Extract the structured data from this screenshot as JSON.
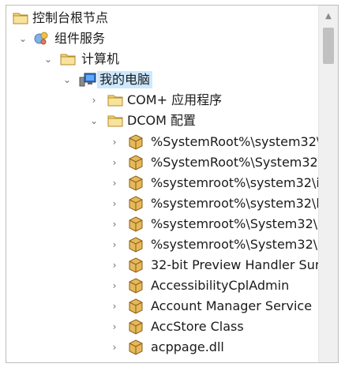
{
  "tree": {
    "root": {
      "label": "控制台根节点",
      "icon": "folder-icon"
    },
    "component_services": {
      "label": "组件服务",
      "icon": "component-services-icon",
      "expanded": true
    },
    "computers": {
      "label": "计算机",
      "icon": "folder-icon",
      "expanded": true
    },
    "my_computer": {
      "label": "我的电脑",
      "icon": "computer-icon",
      "expanded": true,
      "selected": true
    },
    "com_plus": {
      "label": "COM+ 应用程序",
      "icon": "folder-icon",
      "expanded": false
    },
    "dcom_config": {
      "label": "DCOM 配置",
      "icon": "folder-icon",
      "expanded": true
    },
    "dcom_items": [
      {
        "label": "%SystemRoot%\\system32\\"
      },
      {
        "label": "%SystemRoot%\\System32\\"
      },
      {
        "label": "%systemroot%\\system32\\i"
      },
      {
        "label": "%systemroot%\\system32\\l"
      },
      {
        "label": "%systemroot%\\System32\\l"
      },
      {
        "label": "%systemroot%\\System32\\l"
      },
      {
        "label": "32-bit Preview Handler Sur"
      },
      {
        "label": "AccessibilityCplAdmin"
      },
      {
        "label": "Account Manager Service"
      },
      {
        "label": "AccStore Class"
      },
      {
        "label": "acppage.dll"
      }
    ]
  },
  "scrollbar": {
    "position_fraction": 0.0
  },
  "colors": {
    "selection": "#cce8ff",
    "folder": "#f3d67a",
    "package": "#d9a441"
  }
}
